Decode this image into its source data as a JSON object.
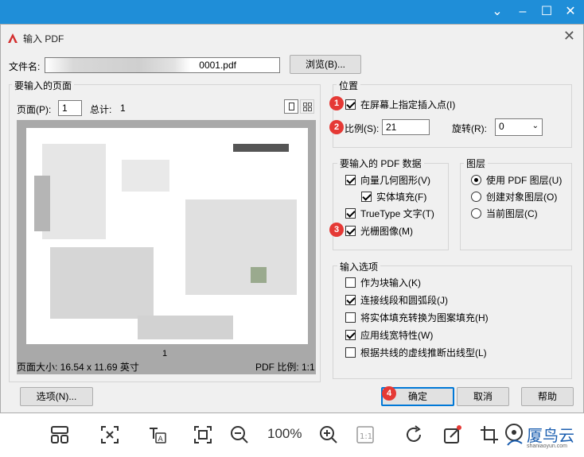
{
  "dialog": {
    "title": "输入 PDF"
  },
  "file": {
    "label": "文件名:",
    "value": "0001.pdf",
    "browse_label": "浏览(B)..."
  },
  "pages": {
    "group_title": "要输入的页面",
    "page_label": "页面(P):",
    "page_value": "1",
    "total_label": "总计:",
    "total_value": "1",
    "page_size": "页面大小: 16.54 x 11.69 英寸",
    "pdf_scale": "PDF 比例: 1:1",
    "preview_page_number": "1"
  },
  "position": {
    "group_title": "位置",
    "specify_label": "在屏幕上指定插入点(I)",
    "specify_checked": true,
    "scale_label": "比例(S):",
    "scale_value": "21",
    "rotation_label": "旋转(R):",
    "rotation_value": "0"
  },
  "pdf_data": {
    "group_title": "要输入的 PDF 数据",
    "items": [
      {
        "label": "向量几何图形(V)",
        "checked": true
      },
      {
        "label": "实体填充(F)",
        "checked": true
      },
      {
        "label": "TrueType 文字(T)",
        "checked": true
      },
      {
        "label": "光栅图像(M)",
        "checked": true
      }
    ]
  },
  "layers": {
    "group_title": "图层",
    "options": [
      {
        "label": "使用 PDF 图层(U)",
        "selected": true
      },
      {
        "label": "创建对象图层(O)",
        "selected": false
      },
      {
        "label": "当前图层(C)",
        "selected": false
      }
    ]
  },
  "import_options": {
    "group_title": "输入选项",
    "items": [
      {
        "label": "作为块输入(K)",
        "checked": false
      },
      {
        "label": "连接线段和圆弧段(J)",
        "checked": true
      },
      {
        "label": "将实体填充转换为图案填充(H)",
        "checked": false
      },
      {
        "label": "应用线宽特性(W)",
        "checked": true
      },
      {
        "label": "根据共线的虚线推断出线型(L)",
        "checked": false
      }
    ]
  },
  "buttons": {
    "options": "选项(N)...",
    "ok": "确定",
    "cancel": "取消",
    "help": "帮助"
  },
  "badges": [
    "1",
    "2",
    "3",
    "4"
  ],
  "viewer": {
    "zoom": "100%",
    "watermark": "厦鸟云",
    "watermark_sub": "shaniaoyun.com"
  },
  "colors": {
    "titlebar": "#1f8ed8",
    "badge": "#e53935",
    "accent": "#0078d7"
  }
}
